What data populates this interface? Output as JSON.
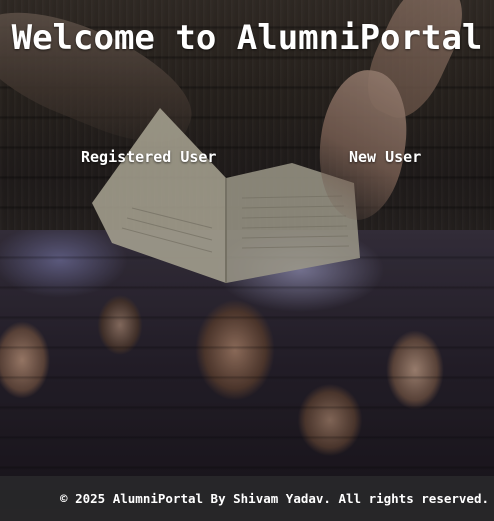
{
  "header": {
    "title": "Welcome to AlumniPortal"
  },
  "nav": {
    "registered_user_label": "Registered User",
    "new_user_label": "New User"
  },
  "footer": {
    "text": "© 2025 AlumniPortal By Shivam Yadav. All rights reserved."
  }
}
